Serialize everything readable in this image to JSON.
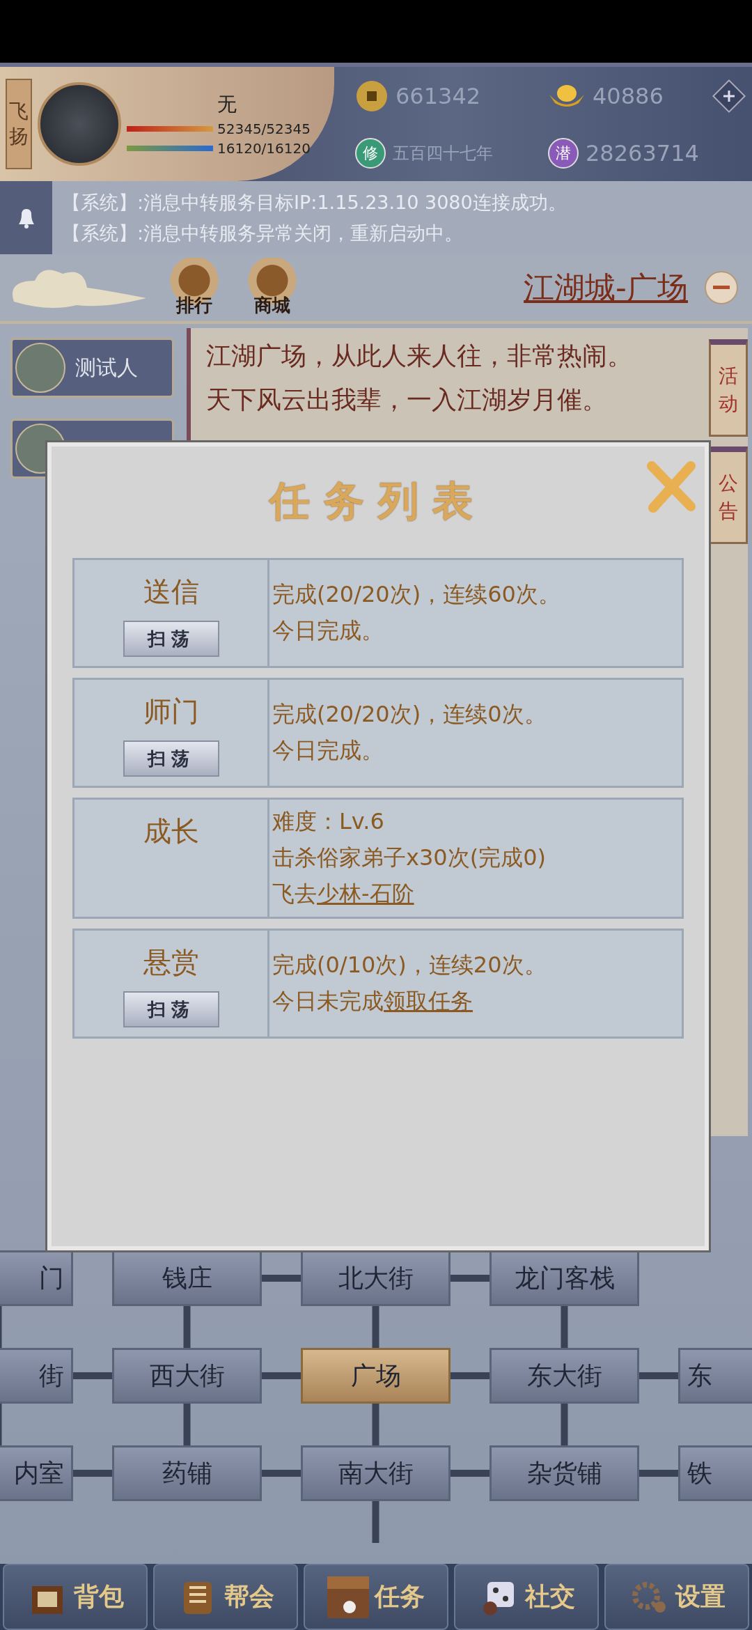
{
  "player": {
    "title": "飞扬",
    "name": "无",
    "hp": {
      "reading": "52345/52345",
      "level": 1
    },
    "mp": {
      "reading": "16120/16120",
      "level": 1
    }
  },
  "currencies": {
    "coins": "661342",
    "gold": "40886",
    "cultivation_badge": "修",
    "cultivation": "五百四十七年",
    "potential_badge": "潜",
    "potential": "28263714"
  },
  "messages": [
    "【系统】:消息中转服务目标IP:1.15.23.10 3080连接成功。",
    "【系统】:消息中转服务异常关闭，重新启动中。"
  ],
  "top_buttons": [
    "排行",
    "商城"
  ],
  "location": "江湖城-广场",
  "players": [
    {
      "name": "测试人"
    }
  ],
  "description": [
    "江湖广场，从此人来人往，非常热闹。",
    "天下风云出我辈，一入江湖岁月催。"
  ],
  "scrolls": [
    "活动",
    "公告"
  ],
  "modal": {
    "title": "任务列表",
    "tasks": [
      {
        "name": "送信",
        "button": "扫荡",
        "lines": [
          {
            "text": "完成(20/20次)，连续60次。"
          },
          {
            "text": "今日完成。"
          }
        ]
      },
      {
        "name": "师门",
        "button": "扫荡",
        "lines": [
          {
            "text": "完成(20/20次)，连续0次。"
          },
          {
            "text": "今日完成。"
          }
        ]
      },
      {
        "name": "成长",
        "lines": [
          {
            "text": "难度：Lv.6"
          },
          {
            "text": "击杀俗家弟子x30次(完成0)"
          },
          {
            "text": "飞去",
            "link": "少林-石阶"
          }
        ]
      },
      {
        "name": "悬赏",
        "button": "扫荡",
        "lines": [
          {
            "text": "完成(0/10次)，连续20次。"
          },
          {
            "text": "今日未完成",
            "link": "领取任务"
          }
        ]
      }
    ]
  },
  "map": {
    "rows": [
      [
        {
          "label": "门",
          "selected": false
        },
        {
          "label": "钱庄",
          "selected": false
        },
        {
          "label": "北大街",
          "selected": false
        },
        {
          "label": "龙门客栈",
          "selected": false
        }
      ],
      [
        {
          "label": "街",
          "selected": false
        },
        {
          "label": "西大街",
          "selected": false
        },
        {
          "label": "广场",
          "selected": true
        },
        {
          "label": "东大街",
          "selected": false
        },
        {
          "label": "东",
          "selected": false
        }
      ],
      [
        {
          "label": "内室",
          "selected": false
        },
        {
          "label": "药铺",
          "selected": false
        },
        {
          "label": "南大街",
          "selected": false
        },
        {
          "label": "杂货铺",
          "selected": false
        },
        {
          "label": "铁",
          "selected": false
        }
      ]
    ]
  },
  "nav": [
    {
      "label": "背包",
      "kind": "bag"
    },
    {
      "label": "帮会",
      "kind": "guild"
    },
    {
      "label": "任务",
      "kind": "task"
    },
    {
      "label": "社交",
      "kind": "social"
    },
    {
      "label": "设置",
      "kind": "settings"
    }
  ]
}
